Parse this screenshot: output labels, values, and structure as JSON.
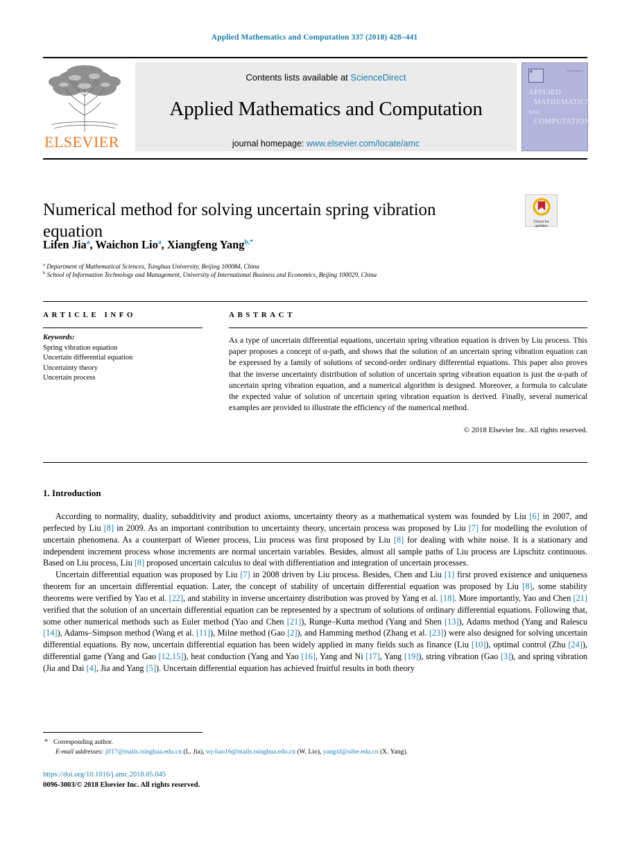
{
  "running_head": "Applied Mathematics and Computation 337 (2018) 428–441",
  "masthead": {
    "publisher": "ELSEVIER",
    "contents_prefix": "Contents lists available at ",
    "contents_link": "ScienceDirect",
    "journal_title": "Applied Mathematics and Computation",
    "homepage_prefix": "journal homepage: ",
    "homepage_url": "www.elsevier.com/locate/amc",
    "cover": {
      "line1": "APPLIED",
      "line2": "MATHEMATICS",
      "line3": "AND",
      "line4": "COMPUTATION",
      "corner_text": "ScienceDirect"
    }
  },
  "article": {
    "title": "Numerical method for solving uncertain spring vibration equation",
    "crossmark_label_line1": "Check for",
    "crossmark_label_line2": "updates",
    "authors_html": "Lifen Jia<sup>a</sup>, Waichon Lio<sup>a</sup>, Xiangfeng Yang<sup>b,*</sup>",
    "affiliation_a": "Department of Mathematical Sciences, Tsinghua University, Beijing 100084, China",
    "affiliation_b": "School of Information Technology and Management, University of International Business and Economics, Beijing 100029, China"
  },
  "article_info": {
    "heading": "ARTICLE INFO",
    "keywords_label": "Keywords:",
    "keywords": [
      "Spring vibration equation",
      "Uncertain differential equation",
      "Uncertainty theory",
      "Uncertain process"
    ]
  },
  "abstract": {
    "heading": "ABSTRACT",
    "text": "As a type of uncertain differential equations, uncertain spring vibration equation is driven by Liu process. This paper proposes a concept of α-path, and shows that the solution of an uncertain spring vibration equation can be expressed by a family of solutions of second-order ordinary differential equations. This paper also proves that the inverse uncertainty distribution of solution of uncertain spring vibration equation is just the α-path of uncertain spring vibration equation, and a numerical algorithm is designed. Moreover, a formula to calculate the expected value of solution of uncertain spring vibration equation is derived. Finally, several numerical examples are provided to illustrate the efficiency of the numerical method.",
    "copyright": "© 2018 Elsevier Inc. All rights reserved."
  },
  "introduction": {
    "heading": "1. Introduction",
    "paragraph1_html": "According to normality, duality, subadditivity and product axioms, uncertainty theory as a mathematical system was founded by Liu <span class=\"ref\">[6]</span> in 2007, and perfected by Liu <span class=\"ref\">[8]</span> in 2009. As an important contribution to uncertainty theory, uncertain process was proposed by Liu <span class=\"ref\">[7]</span> for modelling the evolution of uncertain phenomena. As a counterpart of Wiener process, Liu process was first proposed by Liu <span class=\"ref\">[8]</span> for dealing with white noise. It is a stationary and independent increment process whose increments are normal uncertain variables. Besides, almost all sample paths of Liu process are Lipschitz continuous. Based on Liu process, Liu <span class=\"ref\">[8]</span> proposed uncertain calculus to deal with differentiation and integration of uncertain processes.",
    "paragraph2_html": "Uncertain differential equation was proposed by Liu <span class=\"ref\">[7]</span> in 2008 driven by Liu process. Besides, Chen and Liu <span class=\"ref\">[1]</span> first proved existence and uniqueness theorem for an uncertain differential equation. Later, the concept of stability of uncertain differential equation was proposed by Liu <span class=\"ref\">[8]</span>, some stability theorems were verified by Yao et al. <span class=\"ref\">[22]</span>, and stability in inverse uncertainty distribution was proved by Yang et al. <span class=\"ref\">[18]</span>. More importantly, Yao and Chen <span class=\"ref\">[21]</span> verified that the solution of an uncertain differential equation can be represented by a spectrum of solutions of ordinary differential equations. Following that, some other numerical methods such as Euler method (Yao and Chen <span class=\"ref\">[21]</span>), Runge–Kutta method (Yang and Shen <span class=\"ref\">[13]</span>), Adams method (Yang and Ralescu <span class=\"ref\">[14]</span>), Adams–Simpson method (Wang et al. <span class=\"ref\">[11]</span>), Milne method (Gao <span class=\"ref\">[2]</span>), and Hamming method (Zhang et al. <span class=\"ref\">[23]</span>) were also designed for solving uncertain differential equations. By now, uncertain differential equation has been widely applied in many fields such as finance (Liu <span class=\"ref\">[10]</span>), optimal control (Zhu <span class=\"ref\">[24]</span>), differential game (Yang and Gao <span class=\"ref\">[12,15]</span>), heat conduction (Yang and Yao <span class=\"ref\">[16]</span>, Yang and Ni <span class=\"ref\">[17]</span>, Yang <span class=\"ref\">[19]</span>), string vibration (Gao <span class=\"ref\">[3]</span>), and spring vibration (Jia and Dai <span class=\"ref\">[4]</span>, Jia and Yang <span class=\"ref\">[5]</span>). Uncertain differential equation has achieved fruitful results in both theory"
  },
  "footnotes": {
    "corresponding": "Corresponding author.",
    "emails_label": "E-mail addresses:",
    "emails": [
      {
        "address": "jlf17@mails.tsinghua.edu.cn",
        "name": "(L. Jia)"
      },
      {
        "address": "wj-liao16@mails.tsinghua.edu.cn",
        "name": "(W. Lio)"
      },
      {
        "address": "yangxf@uibe.edu.cn",
        "name": "(X. Yang)"
      }
    ],
    "doi": "https://doi.org/10.1016/j.amc.2018.05.045",
    "issn_line": "0096-3003/© 2018 Elsevier Inc. All rights reserved."
  },
  "colors": {
    "link": "#1a7eab",
    "elsevier_orange": "#e87722",
    "banner_gray": "#ebebeb",
    "cover_purple": "#b3b5dd"
  }
}
